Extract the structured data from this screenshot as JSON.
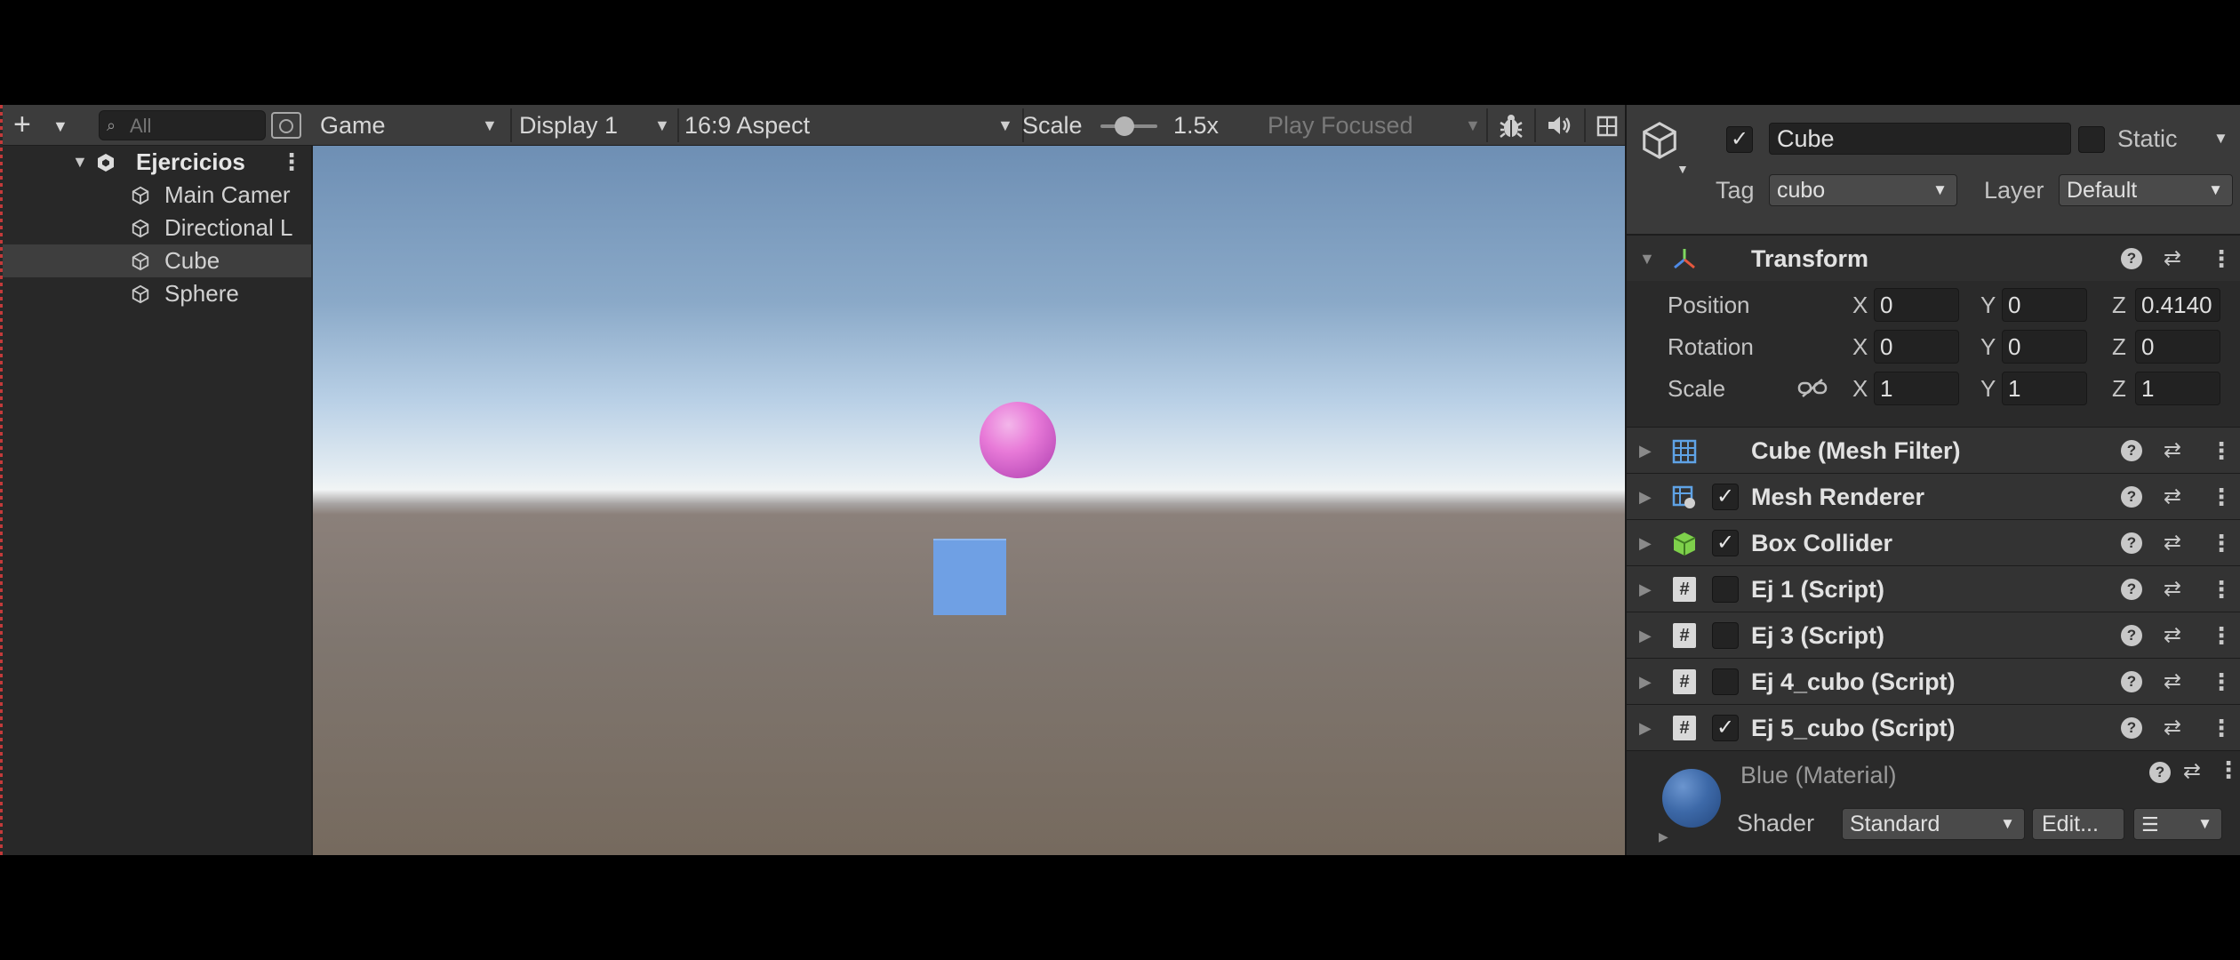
{
  "hierarchy": {
    "search_placeholder": "All",
    "scene_name": "Ejercicios",
    "items": [
      {
        "label": "Main Camer"
      },
      {
        "label": "Directional L"
      },
      {
        "label": "Cube"
      },
      {
        "label": "Sphere"
      }
    ]
  },
  "game_toolbar": {
    "view_mode": "Game",
    "display": "Display 1",
    "aspect": "16:9 Aspect",
    "scale_label": "Scale",
    "scale_value": "1.5x",
    "play_mode": "Play Focused"
  },
  "inspector": {
    "object_name": "Cube",
    "active": true,
    "static_label": "Static",
    "tag_label": "Tag",
    "tag_value": "cubo",
    "layer_label": "Layer",
    "layer_value": "Default",
    "transform": {
      "title": "Transform",
      "rows": [
        {
          "label": "Position",
          "x": "0",
          "y": "0",
          "z": "0.4140"
        },
        {
          "label": "Rotation",
          "x": "0",
          "y": "0",
          "z": "0"
        },
        {
          "label": "Scale",
          "x": "1",
          "y": "1",
          "z": "1"
        }
      ],
      "axis_labels": {
        "x": "X",
        "y": "Y",
        "z": "Z"
      }
    },
    "components": [
      {
        "name": "Cube (Mesh Filter)",
        "icon": "mesh-filter-icon",
        "has_checkbox": false,
        "enabled": false
      },
      {
        "name": "Mesh Renderer",
        "icon": "mesh-renderer-icon",
        "has_checkbox": true,
        "enabled": true
      },
      {
        "name": "Box Collider",
        "icon": "box-collider-icon",
        "has_checkbox": true,
        "enabled": true
      },
      {
        "name": "Ej 1 (Script)",
        "icon": "script-icon",
        "has_checkbox": true,
        "enabled": false
      },
      {
        "name": "Ej 3 (Script)",
        "icon": "script-icon",
        "has_checkbox": true,
        "enabled": false
      },
      {
        "name": "Ej 4_cubo (Script)",
        "icon": "script-icon",
        "has_checkbox": true,
        "enabled": false
      },
      {
        "name": "Ej 5_cubo (Script)",
        "icon": "script-icon",
        "has_checkbox": true,
        "enabled": true
      }
    ],
    "material": {
      "name": "Blue (Material)",
      "shader_label": "Shader",
      "shader_value": "Standard",
      "edit_label": "Edit..."
    }
  },
  "colors": {
    "sphere": "#e87ad8",
    "cube": "#6fa0e4",
    "selected_row": "#3e3e3e",
    "panel_bg": "#282828"
  }
}
